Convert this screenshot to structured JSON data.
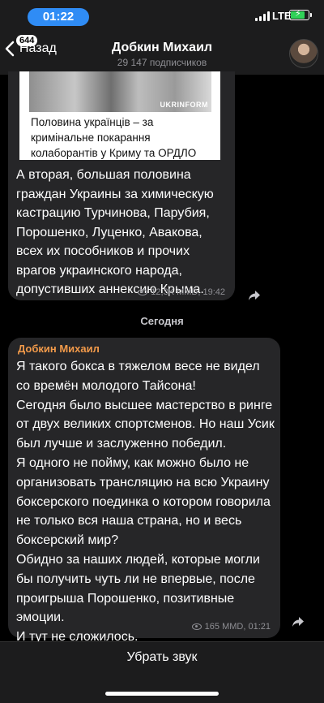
{
  "status_bar": {
    "time": "01:22",
    "network": "LTE"
  },
  "header": {
    "back_label": "Назад",
    "back_count": "644",
    "channel_name": "Добкин Михаил",
    "subscribers": "29 147 подписчиков"
  },
  "messages": [
    {
      "preview_caption": "Половина українців – за кримінальне покарання колаборантів у Криму та ОРДЛО",
      "preview_watermark": "UKRINFORM",
      "text": "А вторая, большая половина граждан Украины за химическую кастрацию Турчинова, Парубия, Порошенко, Луценко, Авакова, всех их пособников и прочих врагов украинского народа, допустивших аннексию Крыма.",
      "views": "12,3K MMD, 19:42"
    },
    {
      "author": "Добкин Михаил",
      "text": "Я такого бокса в тяжелом весе не видел со времён молодого Тайсона!\nСегодня было высшее мастерство в ринге от двух великих спортсменов. Но наш Усик был лучше и заслуженно победил.\nЯ одного не пойму, как можно было не организовать трансляцию на всю Украину боксерского поединка о котором говорила не только вся наша страна, но и весь боксерский мир?\nОбидно за наших людей, которые могли бы получить чуть ли не впервые, после проигрыша Порошенко, позитивные эмоции.\nИ тут не сложилось.",
      "views": "165 MMD, 01:21"
    }
  ],
  "date_separator": "Сегодня",
  "bottom_bar": {
    "mute_label": "Убрать звук"
  },
  "colors": {
    "accent": "#2f8cf5",
    "author": "#f29a4a",
    "bubble": "#262628",
    "battery": "#30d158"
  }
}
